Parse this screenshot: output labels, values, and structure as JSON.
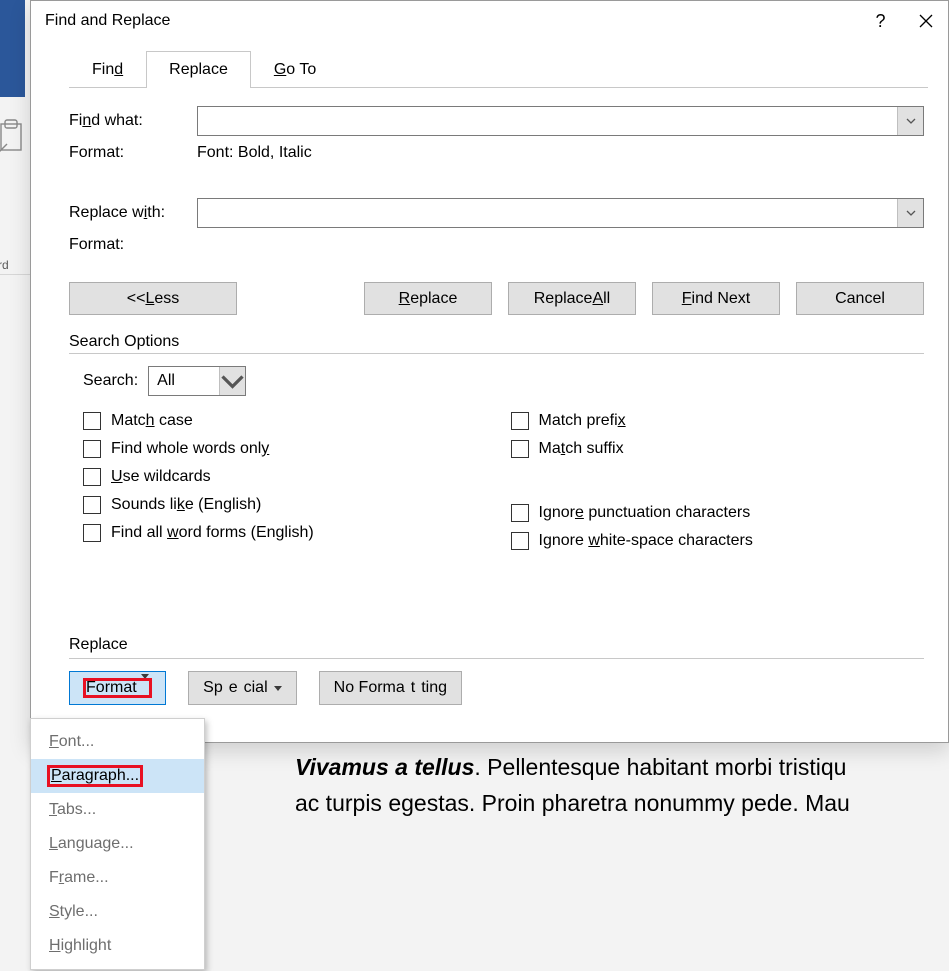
{
  "window": {
    "title": "Find and Replace",
    "help_symbol": "?",
    "close_label": "Close"
  },
  "tabs": {
    "find_pre": "Fin",
    "find_ul": "d",
    "find_post": "",
    "replace_label": "Replace",
    "goto_pre": "",
    "goto_ul": "G",
    "goto_post": "o To"
  },
  "find": {
    "label_pre": "Fi",
    "label_ul": "n",
    "label_post": "d what:",
    "value": "",
    "format_label": "Format:",
    "format_value": "Font: Bold, Italic"
  },
  "replace": {
    "label_pre": "Replace w",
    "label_ul": "i",
    "label_post": "th:",
    "value": "",
    "format_label": "Format:"
  },
  "buttons": {
    "less_pre": "<< ",
    "less_ul": "L",
    "less_post": "ess",
    "replace_pre": "",
    "replace_ul": "R",
    "replace_post": "eplace",
    "replace_all_pre": "Replace ",
    "replace_all_ul": "A",
    "replace_all_post": "ll",
    "find_next_pre": "",
    "find_next_ul": "F",
    "find_next_post": "ind Next",
    "cancel": "Cancel"
  },
  "options": {
    "group_title": "Search Options",
    "search_label_pre": "Searc",
    "search_label_ul": "h",
    "search_label_post": ":",
    "search_value": "All",
    "left": [
      {
        "pre": "Matc",
        "ul": "h",
        "post": " case"
      },
      {
        "pre": "Find whole words onl",
        "ul": "y",
        "post": ""
      },
      {
        "pre": "",
        "ul": "U",
        "post": "se wildcards"
      },
      {
        "pre": "Sounds li",
        "ul": "k",
        "post": "e (English)"
      },
      {
        "pre": "Find all ",
        "ul": "w",
        "post": "ord forms (English)"
      }
    ],
    "right": [
      {
        "pre": "Match prefi",
        "ul": "x",
        "post": ""
      },
      {
        "pre": "Ma",
        "ul": "t",
        "post": "ch suffix"
      },
      {
        "pre": "Ignor",
        "ul": "e",
        "post": " punctuation characters"
      },
      {
        "pre": "Ignore ",
        "ul": "w",
        "post": "hite-space characters"
      }
    ]
  },
  "replace_section": {
    "title": "Replace",
    "format_pre": "F",
    "format_ul": "o",
    "format_post": "rmat",
    "special_pre": "Sp",
    "special_ul": "e",
    "special_post": "cial",
    "nofmt_pre": "No Forma",
    "nofmt_ul": "t",
    "nofmt_post": "ting"
  },
  "menu": {
    "items": [
      {
        "pre": "",
        "ul": "F",
        "post": "ont..."
      },
      {
        "pre": "",
        "ul": "P",
        "post": "aragraph..."
      },
      {
        "pre": "",
        "ul": "T",
        "post": "abs..."
      },
      {
        "pre": "",
        "ul": "L",
        "post": "anguage..."
      },
      {
        "pre": "F",
        "ul": "r",
        "post": "ame..."
      },
      {
        "pre": "",
        "ul": "S",
        "post": "tyle..."
      },
      {
        "pre": "",
        "ul": "H",
        "post": "ighlight"
      }
    ],
    "highlight_index": 1
  },
  "background": {
    "section_label": "board",
    "doc_bold": "Vivamus a tellus",
    "doc_line1_rest": ". Pellentesque habitant morbi tristiqu",
    "doc_line2": "ac turpis egestas. Proin pharetra nonummy pede. Mau"
  }
}
